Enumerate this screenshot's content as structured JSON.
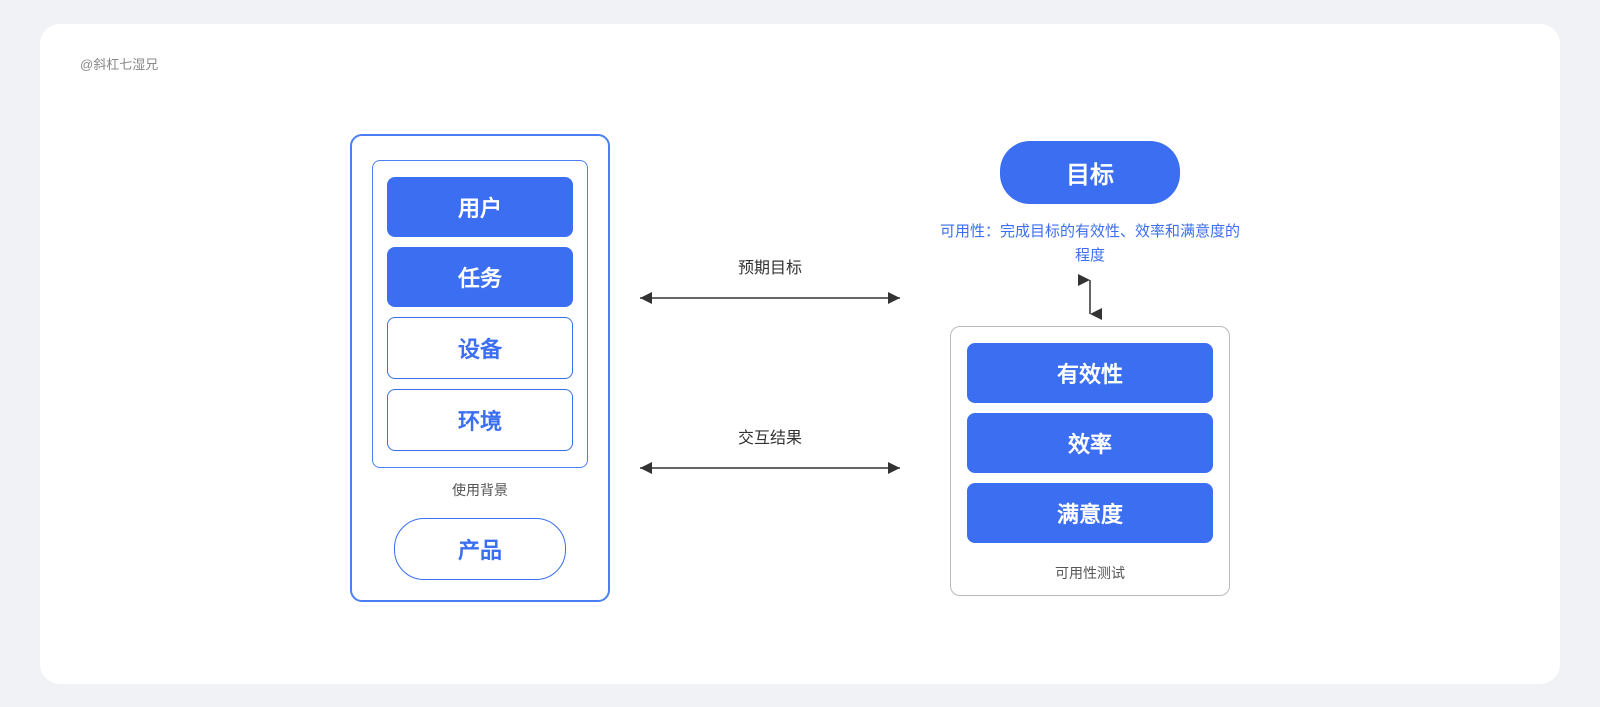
{
  "watermark": "@斜杠七湿兄",
  "left_panel": {
    "inner_items": [
      {
        "label": "用户",
        "type": "filled"
      },
      {
        "label": "任务",
        "type": "filled"
      },
      {
        "label": "设备",
        "type": "outline"
      },
      {
        "label": "环境",
        "type": "outline"
      }
    ],
    "panel_label": "使用背景",
    "product_label": "产品"
  },
  "arrows": {
    "top_label": "预期目标",
    "bottom_label": "交互结果"
  },
  "right_panel": {
    "goal_label": "目标",
    "usability_text": "可用性：完成目标的有效性、效率和满意度的程度",
    "box_items": [
      {
        "label": "有效性",
        "type": "filled"
      },
      {
        "label": "效率",
        "type": "filled"
      },
      {
        "label": "满意度",
        "type": "filled"
      }
    ],
    "box_label": "可用性测试"
  },
  "colors": {
    "blue": "#3b6ef0",
    "blue_light": "#e8eeff",
    "border_blue": "#4a7ff5",
    "text_dark": "#333333",
    "text_muted": "#555555"
  }
}
